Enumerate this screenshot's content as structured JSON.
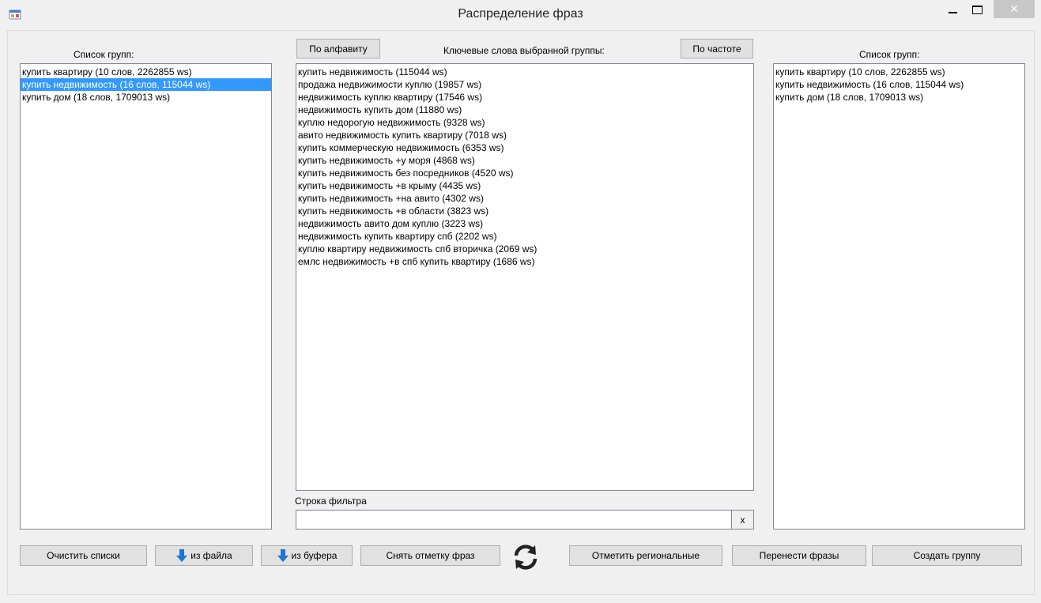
{
  "window": {
    "title": "Распределение фраз",
    "app_icon": "windows-forms-app-icon",
    "close_glyph": "✕"
  },
  "left_panel": {
    "label": "Список групп:",
    "items": [
      "купить квартиру (10 слов, 2262855 ws)",
      "купить недвижимость (16 слов, 115044 ws)",
      "купить дом (18 слов, 1709013 ws)"
    ],
    "selected_index": 1
  },
  "middle_panel": {
    "sort_alpha_button": "По алфавиту",
    "label": "Ключевые слова выбранной группы:",
    "sort_freq_button": "По частоте",
    "keywords": [
      "купить недвижимость (115044 ws)",
      "продажа недвижимости куплю (19857 ws)",
      "недвижимость куплю квартиру (17546 ws)",
      "недвижимость купить дом (11880 ws)",
      "куплю недорогую недвижимость (9328 ws)",
      "авито недвижимость купить квартиру (7018 ws)",
      "купить коммерческую недвижимость (6353 ws)",
      "купить недвижимость +у моря (4868 ws)",
      "купить недвижимость без посредников (4520 ws)",
      "купить недвижимость +в крыму (4435 ws)",
      "купить недвижимость +на авито (4302 ws)",
      "купить недвижимость +в области (3823 ws)",
      "недвижимость авито дом куплю (3223 ws)",
      "недвижимость купить квартиру спб (2202 ws)",
      "куплю квартиру недвижимость спб вторичка (2069 ws)",
      "емлс недвижимость +в спб купить квартиру (1686 ws)"
    ],
    "filter_label": "Строка фильтра",
    "filter_value": "",
    "clear_filter_button": "x"
  },
  "right_panel": {
    "label": "Список групп:",
    "items": [
      "купить квартиру (10 слов, 2262855 ws)",
      "купить недвижимость (16 слов, 115044 ws)",
      "купить дом (18 слов, 1709013 ws)"
    ]
  },
  "bottom_bar": {
    "clear_lists": "Очистить списки",
    "from_file": "из файла",
    "from_clipboard": "из буфера",
    "uncheck_phrases": "Снять отметку фраз",
    "refresh_icon": "refresh-icon",
    "mark_regional": "Отметить региональные",
    "move_phrases": "Перенести фразы",
    "create_group": "Создать группу"
  },
  "colors": {
    "selection": "#3399ff",
    "arrow_icon": "#1e74d0",
    "window_bg": "#f0f0f0"
  }
}
